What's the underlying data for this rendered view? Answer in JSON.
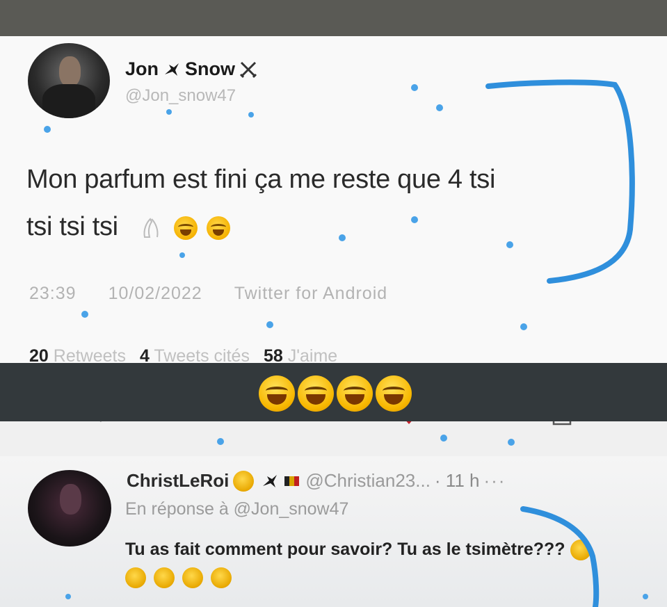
{
  "tweet": {
    "display_name_first": "Jon",
    "display_name_last": "Snow",
    "handle": "@Jon_snow47",
    "text_line1": "Mon parfum est fini ça me reste que 4 tsi",
    "text_line2": "tsi tsi tsi",
    "time": "23:39",
    "date": "10/02/2022",
    "source": "Twitter for Android",
    "stats": {
      "retweets_count": "20",
      "retweets_label": "Retweets",
      "quotes_count": "4",
      "quotes_label": "Tweets cités",
      "likes_count": "58",
      "likes_label": "J'aime"
    }
  },
  "reply": {
    "display_name": "ChristLeRoi",
    "handle": "@Christian23...",
    "age": "· 11 h",
    "more": "···",
    "in_reply_to": "En réponse à @Jon_snow47",
    "text": "Tu as fait comment pour savoir? Tu as le tsimètre???"
  },
  "overlay": {
    "laugh_emoji_count": 4
  },
  "colors": {
    "doodle_blue": "#2f8fdc",
    "band": "#33393c",
    "top_bar": "#5a5a55"
  }
}
